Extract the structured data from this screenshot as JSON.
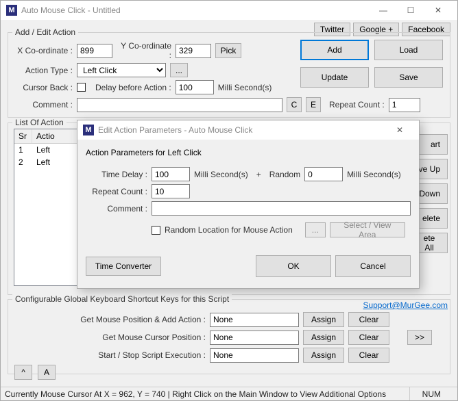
{
  "main_window": {
    "title": "Auto Mouse Click - Untitled",
    "social": {
      "twitter": "Twitter",
      "google": "Google +",
      "facebook": "Facebook"
    },
    "add_edit": {
      "legend": "Add / Edit Action",
      "xco_label": "X Co-ordinate :",
      "xco_value": "899",
      "yco_label": "Y Co-ordinate :",
      "yco_value": "329",
      "pick": "Pick",
      "action_type_label": "Action Type :",
      "action_type_value": "Left Click",
      "more": "...",
      "cursor_back_label": "Cursor Back :",
      "delay_label": "Delay before Action :",
      "delay_value": "100",
      "delay_unit": "Milli Second(s)",
      "comment_label": "Comment :",
      "comment_value": "",
      "c_btn": "C",
      "e_btn": "E",
      "repeat_label": "Repeat Count :",
      "repeat_value": "1",
      "add": "Add",
      "load": "Load",
      "update": "Update",
      "save": "Save"
    },
    "list": {
      "legend": "List Of Action",
      "cols": {
        "sr": "Sr",
        "action": "Actio"
      },
      "rows": [
        {
          "sr": "1",
          "action": "Left"
        },
        {
          "sr": "2",
          "action": "Left"
        }
      ]
    },
    "side": {
      "start": "art",
      "move_up": "ve Up",
      "move_down": "Down",
      "delete": "elete",
      "delete_all": "ete All"
    },
    "shortcuts": {
      "legend": "Configurable Global Keyboard Shortcut Keys for this Script",
      "rows": [
        {
          "label": "Get Mouse Position & Add Action :",
          "value": "None"
        },
        {
          "label": "Get Mouse Cursor Position :",
          "value": "None"
        },
        {
          "label": "Start / Stop Script Execution :",
          "value": "None"
        }
      ],
      "assign": "Assign",
      "clear": "Clear",
      "more": ">>"
    },
    "caret_btn": "^",
    "a_btn": "A",
    "support": "Support@MurGee.com",
    "status": "Currently Mouse Cursor At X = 962, Y = 740 | Right Click on the Main Window to View Additional Options",
    "num": "NUM"
  },
  "dialog": {
    "title": "Edit Action Parameters - Auto Mouse Click",
    "heading": "Action Parameters for Left Click",
    "time_delay_label": "Time Delay :",
    "time_delay_value": "100",
    "time_delay_unit": "Milli Second(s)",
    "plus": "+",
    "random_label": "Random",
    "random_value": "0",
    "random_unit": "Milli Second(s)",
    "repeat_label": "Repeat Count :",
    "repeat_value": "10",
    "comment_label": "Comment :",
    "comment_value": "",
    "random_loc": "Random Location for Mouse Action",
    "ellipsis": "...",
    "select_area": "Select / View Area",
    "time_converter": "Time Converter",
    "ok": "OK",
    "cancel": "Cancel"
  }
}
